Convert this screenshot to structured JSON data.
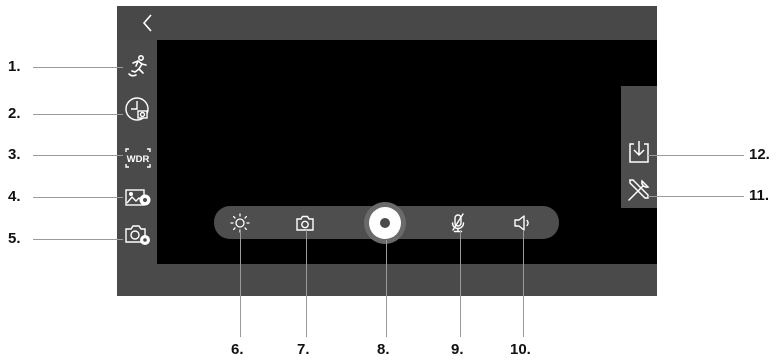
{
  "colors": {
    "device": "#4a4a4a",
    "video": "#000000",
    "icon": "#ffffff",
    "leader": "#9a9a9a",
    "callout_text": "#111111"
  },
  "icons": {
    "back": "chevron-left-icon",
    "motion": "running-person-icon",
    "timer": "clock-camera-icon",
    "wdr": "wdr-icon",
    "image_settings": "image-gear-icon",
    "capture_settings": "camera-gear-icon",
    "brightness": "sun-icon",
    "snapshot": "camera-icon",
    "record": "record-icon",
    "mic": "microphone-mute-icon",
    "speaker": "speaker-icon",
    "download": "download-icon",
    "tools": "tools-icon"
  },
  "left_panel": {
    "wdr_label": "WDR"
  },
  "callouts": {
    "c1": "1.",
    "c2": "2.",
    "c3": "3.",
    "c4": "4.",
    "c5": "5.",
    "c6": "6.",
    "c7": "7.",
    "c8": "8.",
    "c9": "9.",
    "c10": "10.",
    "c11": "11.",
    "c12": "12."
  }
}
